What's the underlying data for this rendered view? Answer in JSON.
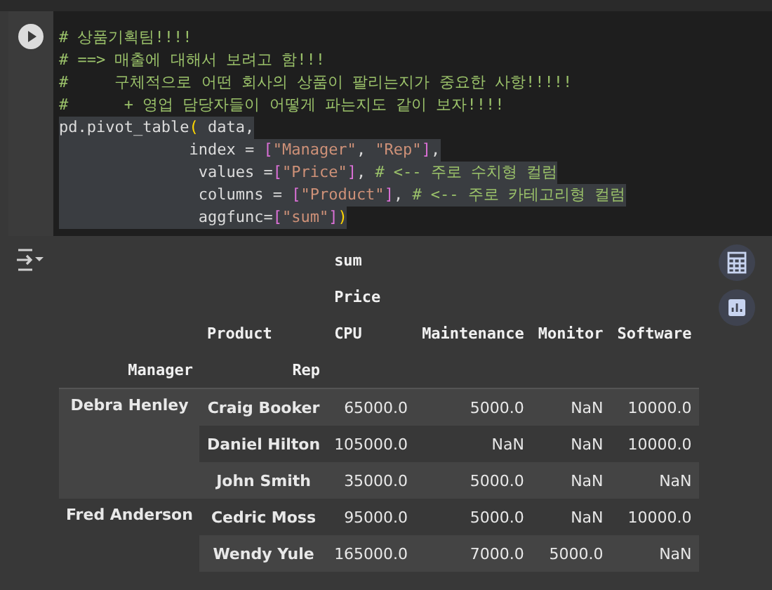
{
  "code_cell": {
    "lines": [
      {
        "selected": false,
        "tokens": [
          {
            "kind": "comment",
            "text": "# 상품기획팀!!!!"
          }
        ]
      },
      {
        "selected": false,
        "tokens": [
          {
            "kind": "comment",
            "text": "# ==> 매출에 대해서 보려고 함!!!"
          }
        ]
      },
      {
        "selected": false,
        "tokens": [
          {
            "kind": "comment",
            "text": "#     구체적으로 어떤 회사의 상품이 팔리는지가 중요한 사항!!!!!"
          }
        ]
      },
      {
        "selected": false,
        "tokens": [
          {
            "kind": "comment",
            "text": "#      + 영업 담당자들이 어떻게 파는지도 같이 보자!!!!"
          }
        ]
      },
      {
        "selected": true,
        "tokens": [
          {
            "kind": "plain",
            "text": "pd.pivot_table"
          },
          {
            "kind": "paren",
            "text": "("
          },
          {
            "kind": "plain",
            "text": " data,"
          }
        ]
      },
      {
        "selected": true,
        "tokens": [
          {
            "kind": "plain",
            "text": "              index = "
          },
          {
            "kind": "bracket",
            "text": "["
          },
          {
            "kind": "string",
            "text": "\"Manager\""
          },
          {
            "kind": "plain",
            "text": ", "
          },
          {
            "kind": "string",
            "text": "\"Rep\""
          },
          {
            "kind": "bracket",
            "text": "]"
          },
          {
            "kind": "plain",
            "text": ","
          }
        ]
      },
      {
        "selected": true,
        "tokens": [
          {
            "kind": "plain",
            "text": "               values ="
          },
          {
            "kind": "bracket",
            "text": "["
          },
          {
            "kind": "string",
            "text": "\"Price\""
          },
          {
            "kind": "bracket",
            "text": "]"
          },
          {
            "kind": "plain",
            "text": ", "
          },
          {
            "kind": "comment",
            "text": "# <-- 주로 수치형 컬럼"
          }
        ]
      },
      {
        "selected": true,
        "tokens": [
          {
            "kind": "plain",
            "text": "               columns = "
          },
          {
            "kind": "bracket",
            "text": "["
          },
          {
            "kind": "string",
            "text": "\"Product\""
          },
          {
            "kind": "bracket",
            "text": "]"
          },
          {
            "kind": "plain",
            "text": ", "
          },
          {
            "kind": "comment",
            "text": "# <-- 주로 카테고리형 컬럼"
          }
        ]
      },
      {
        "selected": true,
        "tokens": [
          {
            "kind": "plain",
            "text": "               aggfunc="
          },
          {
            "kind": "bracket",
            "text": "["
          },
          {
            "kind": "string",
            "text": "\"sum\""
          },
          {
            "kind": "bracket",
            "text": "]"
          },
          {
            "kind": "paren",
            "text": ")"
          }
        ]
      }
    ]
  },
  "table": {
    "column_header_rows": [
      {
        "cells": [
          "sum"
        ]
      },
      {
        "cells": [
          "Price"
        ]
      },
      {
        "label": "Product",
        "cells": [
          "CPU",
          "Maintenance",
          "Monitor",
          "Software"
        ]
      }
    ],
    "index_names": [
      "Manager",
      "Rep"
    ],
    "groups": [
      {
        "manager": "Debra Henley",
        "rows": [
          {
            "rep": "Craig Booker",
            "values": [
              "65000.0",
              "5000.0",
              "NaN",
              "10000.0"
            ]
          },
          {
            "rep": "Daniel Hilton",
            "values": [
              "105000.0",
              "NaN",
              "NaN",
              "10000.0"
            ]
          },
          {
            "rep": "John Smith",
            "values": [
              "35000.0",
              "5000.0",
              "NaN",
              "NaN"
            ]
          }
        ]
      },
      {
        "manager": "Fred Anderson",
        "rows": [
          {
            "rep": "Cedric Moss",
            "values": [
              "95000.0",
              "5000.0",
              "NaN",
              "10000.0"
            ]
          },
          {
            "rep": "Wendy Yule",
            "values": [
              "165000.0",
              "7000.0",
              "5000.0",
              "NaN"
            ]
          }
        ]
      }
    ]
  }
}
